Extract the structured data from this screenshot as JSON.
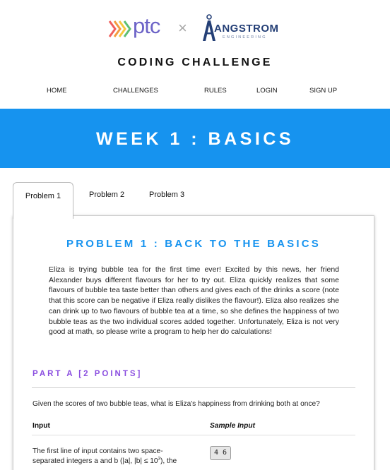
{
  "header": {
    "logo_left_text": "ptc",
    "separator": "×",
    "logo_right_name": "ANGSTROM",
    "logo_right_sub": "ENGINEERING",
    "site_title": "CODING CHALLENGE"
  },
  "nav": {
    "items": [
      "HOME",
      "CHALLENGES",
      "RULES",
      "LOGIN",
      "SIGN UP"
    ]
  },
  "banner": {
    "title": "WEEK 1 : BASICS"
  },
  "tabs": {
    "items": [
      "Problem 1",
      "Problem 2",
      "Problem 3"
    ],
    "active": "Problem 1"
  },
  "problem": {
    "title": "PROBLEM 1 : BACK TO THE BASICS",
    "description": "Eliza is trying bubble tea for the first time ever! Excited by this news, her friend Alexander buys different flavours for her to try out. Eliza quickly realizes that some flavours of bubble tea taste better than others and gives each of the drinks a score (note that this score can be negative if Eliza really dislikes the flavour!). Eliza also realizes she can drink up to two flavours of bubble tea at a time, so she defines the happiness of two bubble teas as the two individual scores added together. Unfortunately, Eliza is not very good at math, so please write a program to help her do calculations!",
    "part_a": {
      "title": "PART A [2 POINTS]",
      "question": "Given the scores of two bubble teas, what is Eliza's happiness from drinking both at once?",
      "input_header": "Input",
      "sample_header": "Sample Input",
      "input_desc_a": "The first line of input contains two space-separated integers a and b (|a|, |b| ≤ 10",
      "input_desc_exp": "3",
      "input_desc_b": "), the",
      "sample_input": "4 6"
    }
  },
  "colors": {
    "banner": "#1693ef",
    "problem_title": "#1693ef",
    "part_title": "#8b4fe0",
    "angstrom_navy": "#243f76",
    "ptc_purple": "#6c63c7"
  }
}
